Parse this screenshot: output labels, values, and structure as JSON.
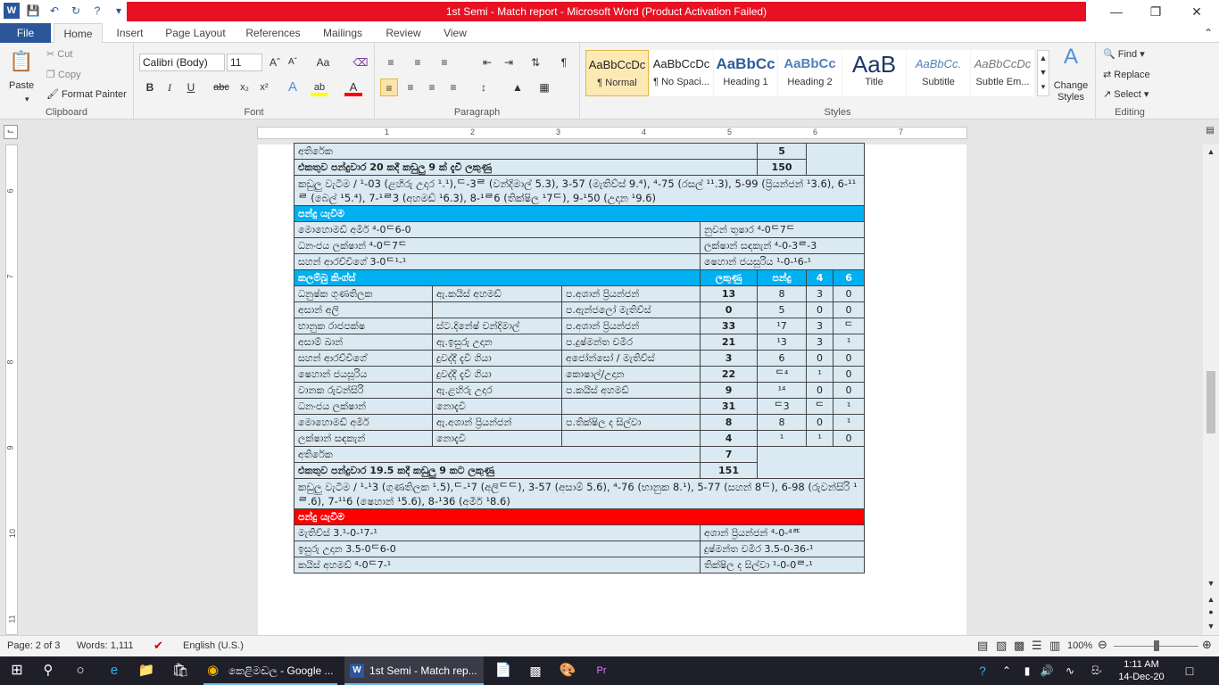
{
  "window": {
    "title": "1st Semi  -  Match report  -  Microsoft Word (Product Activation Failed)"
  },
  "tabs": [
    "File",
    "Home",
    "Insert",
    "Page Layout",
    "References",
    "Mailings",
    "Review",
    "View"
  ],
  "ribbon": {
    "clipboard": {
      "paste": "Paste",
      "cut": "Cut",
      "copy": "Copy",
      "format_painter": "Format Painter",
      "label": "Clipboard"
    },
    "font": {
      "name": "Calibri (Body)",
      "size": "11",
      "label": "Font"
    },
    "paragraph": {
      "label": "Paragraph"
    },
    "styles": {
      "label": "Styles",
      "items": [
        {
          "preview": "AaBbCcDc",
          "name": "¶ Normal"
        },
        {
          "preview": "AaBbCcDc",
          "name": "¶ No Spaci..."
        },
        {
          "preview": "AaBbCc",
          "name": "Heading 1"
        },
        {
          "preview": "AaBbCc",
          "name": "Heading 2"
        },
        {
          "preview": "AaB",
          "name": "Title"
        },
        {
          "preview": "AaBbCc.",
          "name": "Subtitle"
        },
        {
          "preview": "AaBbCcDc",
          "name": "Subtle Em..."
        }
      ],
      "change": "Change Styles"
    },
    "editing": {
      "find": "Find",
      "replace": "Replace",
      "select": "Select",
      "label": "Editing"
    }
  },
  "ruler": {
    "h": [
      "1",
      "2",
      "3",
      "4",
      "5",
      "6",
      "7"
    ],
    "v": [
      "6",
      "7",
      "8",
      "9",
      "10",
      "11"
    ]
  },
  "table": {
    "top": [
      {
        "label": "අතිරේක",
        "value": "5"
      },
      {
        "label": "එකතුව පන්දුවාර 20 කදී කඩුලු 9 ක් දැවී ලකුණු",
        "value": "150"
      }
    ],
    "fow1": "කඩුලු වැටීම / ¹-03 (ළහිරු උදාර ¹.¹),ᄃ-3ᄅ (වන්දිමාල් 5.3), 3-57 (මැතිව්ස් 9.⁴), ⁴-75 (රසල් ¹¹.3), 5-99 (ප්‍රියන්ජන් ¹3.6), 6-¹¹ᄅ (බෙල් ¹5.⁴), 7-¹ᄅ3 (අහමඩ් ¹6.3), 8-¹ᄅ6 (තික්ෂිල ¹7ᄃ), 9-¹50 (උදාන ¹9.6)",
    "bowl1_title": "පන්දු යැවීම",
    "bowl1": [
      [
        "මොහොමඩ් අමීර් ⁴-0ᄃ6-0",
        "නුවන් තුෂාර ⁴-0ᄃ7ᄃ"
      ],
      [
        "ධනංජය ලක්ෂාන් ⁴-0ᄃ7ᄃ",
        "ලක්ෂාන් සඳකැන් ⁴-0-3ᄅ-3"
      ],
      [
        "සහන් ආරච්චිගේ 3-0ᄃ¹-¹",
        "ෂෙහාන් ජයසූරිය ¹-0-¹6-¹"
      ]
    ],
    "bat2_header": {
      "team": "කලම්බු කිංග්ස්",
      "runs": "ලකුණු",
      "balls": "පන්දු",
      "fours": "4",
      "sixes": "6"
    },
    "bat2": [
      [
        "ධනුෂ්ක ගුණතිලක",
        "ඇ.කයිස් අහමඩ්",
        "ප.අශාන් ප්‍රියන්ජන්",
        "13",
        "8",
        "3",
        "0"
      ],
      [
        "අසාන් අලි",
        "",
        "ප.ඇන්ජලෝ මැතිව්ස්",
        "0",
        "5",
        "0",
        "0"
      ],
      [
        "භානුක රාජපක්ෂ",
        "ස්ට.දිනේෂ් චන්දිමාල්",
        "ප.අශාන් ප්‍රියන්ජන්",
        "33",
        "¹7",
        "3",
        "ᄃ"
      ],
      [
        "අසාම් ඛාන්",
        "ඇ.ඉසුරු උදාන",
        "ප.දුෂ්මන්ත චමීර",
        "21",
        "¹3",
        "3",
        "¹"
      ],
      [
        "සහන් ආරච්චිගේ",
        "දුවද්දී දැවී ගියා",
        "අජෝන්සෝ / මැතිව්ස්",
        "3",
        "6",
        "0",
        "0"
      ],
      [
        "ෂෙහාන් ජයසූරිය",
        "දුවද්දී දැවී ගියා",
        "කොෂාල්/උදාන",
        "22",
        "ᄃ⁴",
        "¹",
        "0"
      ],
      [
        "වානක රුවන්සිරි",
        "ඇ.ළහිරු උදාර",
        "ප.කයිස් අහමඩ්",
        "9",
        "¹⁴",
        "0",
        "0"
      ],
      [
        "ධනංජය ලක්ෂාන්",
        "නොදැවී",
        "",
        "31",
        "ᄃ3",
        "ᄃ",
        "¹"
      ],
      [
        "මොහොමඩ් අමීර්",
        "ඇ.අශාන් ප්‍රියන්ජන්",
        "ප.තික්ෂිල ද සිල්වා",
        "8",
        "8",
        "0",
        "¹"
      ],
      [
        "ලක්ෂාන් සඳකැන්",
        "නොදැවී",
        "",
        "4",
        "¹",
        "¹",
        "0"
      ]
    ],
    "bottom": [
      {
        "label": "අතිරේක",
        "value": "7"
      },
      {
        "label": "එකතුව පන්දුවාර 19.5 කදී කඩුලු 9 කට ලකුණු",
        "value": "151"
      }
    ],
    "fow2": "කඩුලු වැටීම / ¹-¹3 (ගුණතිලක ¹.5),ᄃ-¹7 (අලිᄃᄃ), 3-57 (අසාම් 5.6), ⁴-76 (භානුක 8.¹), 5-77 (සහන් 8ᄃ), 6-98 (රුවන්සිරි ¹ᄅ.6), 7-¹¹6 (ෂෙහාන් ¹5.6), 8-¹36 (අමීර් ¹8.6)",
    "bowl2_title": "පන්දු යැවීම",
    "bowl2": [
      [
        "මැතිව්ස් 3.¹-0-¹7-¹",
        "අශාන් ප්‍රියන්ජන් ⁴-0-⁴ᄅᄃ"
      ],
      [
        "ඉසුරු උදාන 3.5-0ᄃ6-0",
        "දුෂ්මන්ත චමීර 3.5-0-36-¹"
      ],
      [
        "කයිස් අහමඩ් ⁴-0ᄃ7-¹",
        "තික්ෂිල ද සිල්වා ¹-0-0ᄅ-¹"
      ]
    ]
  },
  "status": {
    "page": "Page: 2 of 3",
    "words": "Words: 1,111",
    "lang": "English (U.S.)",
    "zoom": "100%"
  },
  "taskbar": {
    "chrome": "කෙළිමඬල - Google ...",
    "word": "1st Semi - Match rep...",
    "time": "1:11 AM",
    "date": "14-Dec-20",
    "lang": "සිං"
  }
}
